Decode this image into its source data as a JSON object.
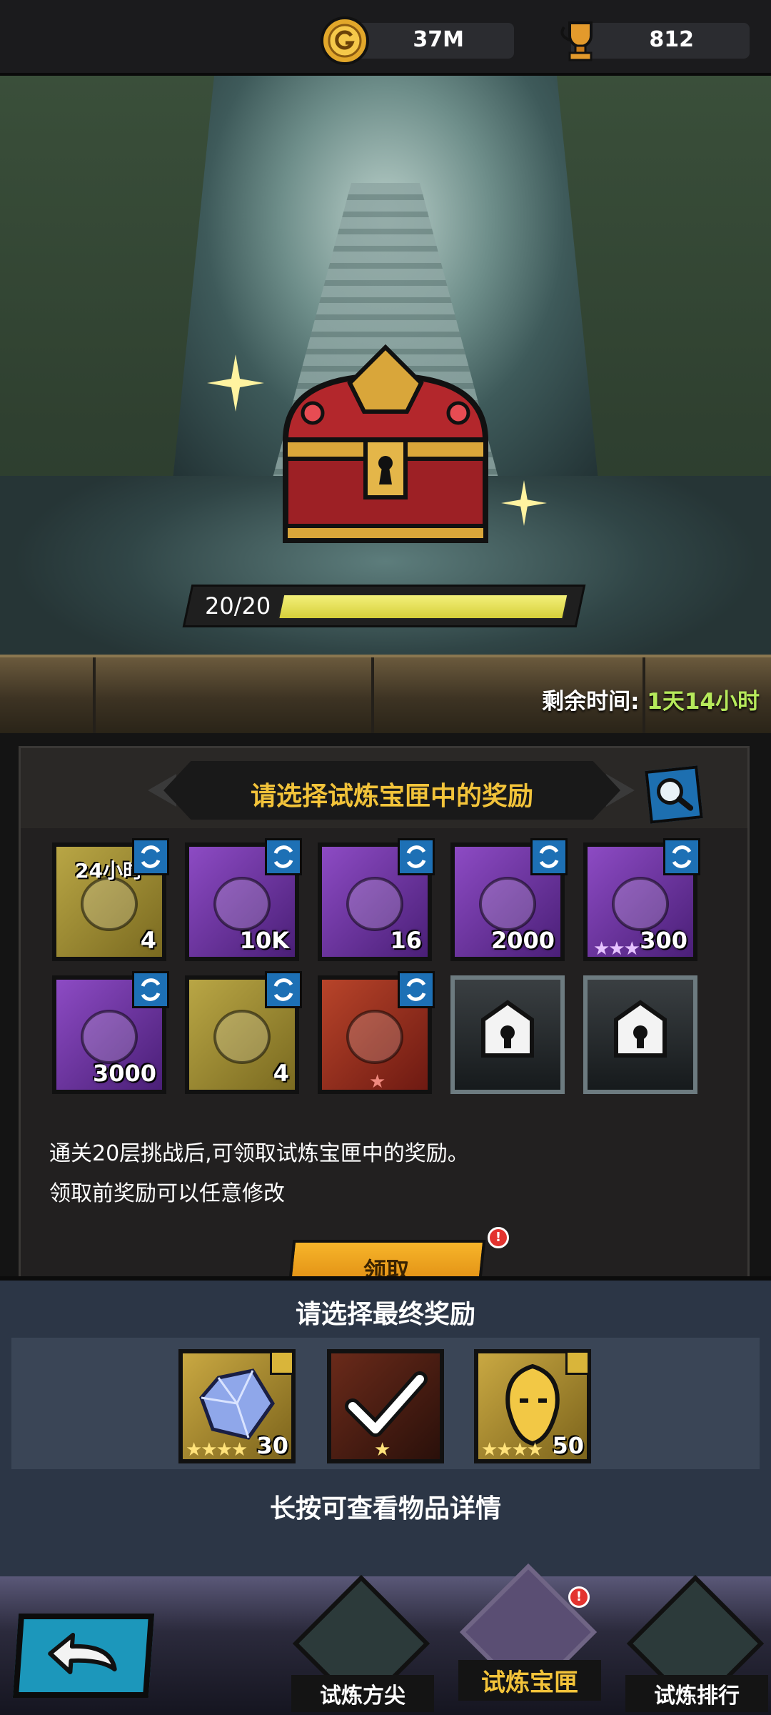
{
  "currency": {
    "gold": {
      "icon": "gold-coin-icon",
      "value": "37M"
    },
    "trophy": {
      "icon": "trophy-cup-icon",
      "value": "812"
    }
  },
  "chest": {
    "progress_text": "20/20",
    "progress_fraction": 1.0,
    "timer_label": "剩余时间:",
    "timer_value": "1天14小时"
  },
  "panel": {
    "title": "请选择试炼宝匣中的奖励",
    "slots": [
      {
        "type": "gold",
        "top": "24小时",
        "qty": "4",
        "icon": "treasure-pile-icon",
        "swap": true
      },
      {
        "type": "purple",
        "qty": "10K",
        "icon": "compass-icon",
        "swap": true
      },
      {
        "type": "purple",
        "qty": "16",
        "icon": "gift-ticket-icon",
        "swap": true
      },
      {
        "type": "purple",
        "qty": "2000",
        "icon": "red-gem-icon",
        "swap": true
      },
      {
        "type": "purple",
        "qty": "300",
        "icon": "purple-hero-icon",
        "stars": "★★★",
        "swap": true
      },
      {
        "type": "purple",
        "qty": "3000",
        "icon": "red-gem-icon",
        "swap": true
      },
      {
        "type": "gold",
        "qty": "4",
        "icon": "winged-chest-icon",
        "swap": true
      },
      {
        "type": "red",
        "qty": "",
        "icon": "fire-hero-icon",
        "stars": "★",
        "swap": true
      },
      {
        "type": "locked",
        "qty": "",
        "icon": "lock-icon",
        "swap": false
      },
      {
        "type": "locked",
        "qty": "",
        "icon": "lock-icon",
        "swap": false
      }
    ],
    "note_line1": "通关20层挑战后,可领取试炼宝匣中的奖励。",
    "note_line2": "领取前奖励可以任意修改",
    "claim_label": "领取",
    "claim_badge": "!"
  },
  "final": {
    "title": "请选择最终奖励",
    "items": [
      {
        "qty": "30",
        "stars": "★★★★",
        "icon": "blue-crystal-icon"
      },
      {
        "qty": "",
        "stars": "★",
        "icon": "checkmark-icon",
        "selected": true
      },
      {
        "qty": "50",
        "stars": "★★★★",
        "icon": "gold-hero-icon"
      }
    ],
    "footer": "长按可查看物品详情"
  },
  "nav": {
    "back_icon": "back-arrow-icon",
    "tabs": [
      {
        "label": "试炼方尖",
        "active": false
      },
      {
        "label": "试炼宝匣",
        "active": true,
        "badge": "!"
      },
      {
        "label": "试炼排行",
        "active": false
      }
    ]
  },
  "colors": {
    "accent_gold": "#f2c33a",
    "timer_green": "#b6e95b",
    "swap_blue": "#1d70b5",
    "progress_yellow": "#e8e35a"
  }
}
